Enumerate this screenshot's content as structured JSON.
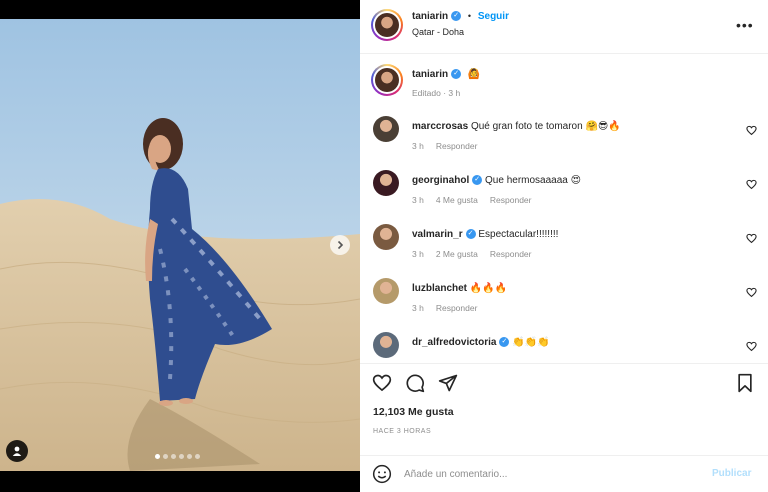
{
  "post": {
    "username": "taniarin",
    "follow_label": "Seguir",
    "location": "Qatar - Doha",
    "more_icon": "more-horizontal-icon",
    "caption_emoji": "🙆",
    "caption_meta": "Editado · 3 h"
  },
  "comments": [
    {
      "username": "marccrosas",
      "text": "Qué gran foto te tomaron",
      "emoji": "🤗😎🔥",
      "time": "3 h",
      "likes": "",
      "reply": "Responder",
      "verified": false,
      "avatar_color": "#4a3f35"
    },
    {
      "username": "georginahol",
      "text": "Que hermosaaaaa",
      "emoji": "😍",
      "time": "3 h",
      "likes": "4 Me gusta",
      "reply": "Responder",
      "verified": true,
      "avatar_color": "#3a1a22"
    },
    {
      "username": "valmarin_r",
      "text": "Espectacular!!!!!!!!",
      "emoji": "",
      "time": "3 h",
      "likes": "2 Me gusta",
      "reply": "Responder",
      "verified": true,
      "avatar_color": "#7a5a40"
    },
    {
      "username": "luzblanchet",
      "text": "",
      "emoji": "🔥🔥🔥",
      "time": "3 h",
      "likes": "",
      "reply": "Responder",
      "verified": false,
      "avatar_color": "#b59a6a"
    },
    {
      "username": "dr_alfredovictoria",
      "text": "",
      "emoji": "👏👏👏",
      "time": "",
      "likes": "",
      "reply": "",
      "verified": true,
      "avatar_color": "#5c6a7a"
    }
  ],
  "actions": {
    "likes": "12,103 Me gusta",
    "time": "HACE 3 HORAS"
  },
  "add_comment": {
    "placeholder": "Añade un comentario...",
    "publish_label": "Publicar"
  },
  "carousel": {
    "count": 6,
    "active": 0
  },
  "colors": {
    "accent": "#0095f6",
    "verified": "#3897f0",
    "muted": "#8e8e8e",
    "sky": "#a9c9e0",
    "sand": "#d8c29e"
  }
}
